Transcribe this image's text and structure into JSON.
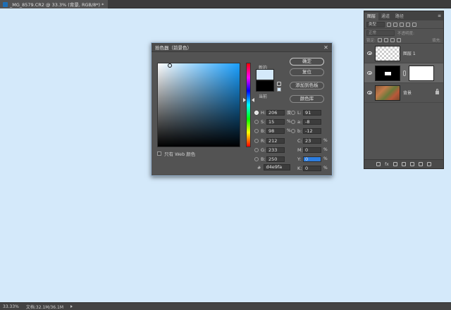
{
  "document": {
    "tab_title": "_MG_8579.CR2 @ 33.3% (背景, RGB/8*) *"
  },
  "status": {
    "zoom": "33.33%",
    "doc_info": "文档:32.1M/36.1M"
  },
  "color_picker": {
    "title": "拾色器（前景色）",
    "label_new": "新的",
    "label_current": "当前",
    "new_color": "#d4e9fa",
    "current_color": "#000000",
    "buttons": {
      "ok": "确定",
      "reset": "复位",
      "add_swatch": "添加到色板",
      "color_libraries": "颜色库"
    },
    "web_only_label": "只有 Web 颜色",
    "fields": {
      "H": "206",
      "H_unit": "度",
      "S": "15",
      "S_unit": "%",
      "B": "98",
      "B_unit": "%",
      "R": "212",
      "G": "233",
      "Bv": "250",
      "L": "91",
      "a": "-8",
      "b": "-12",
      "C": "23",
      "C_unit": "%",
      "M": "0",
      "M_unit": "%",
      "Y": "0",
      "Y_unit": "%",
      "K": "0",
      "K_unit": "%"
    },
    "field_labels": {
      "H": "H:",
      "S": "S:",
      "B": "B:",
      "R": "R:",
      "G": "G:",
      "Bv": "B:",
      "L": "L:",
      "a": "a:",
      "b": "b:",
      "C": "C:",
      "M": "M:",
      "Y": "Y:",
      "K": "K:"
    },
    "hex_label": "#",
    "hex": "d4e9fa"
  },
  "layers_panel": {
    "tabs": [
      "图层",
      "通道",
      "路径"
    ],
    "filter_label": "类型",
    "blend_mode": "正常",
    "opacity_label": "不透明度:",
    "lock_label": "锁定:",
    "fill_label": "填充:",
    "layers": [
      {
        "name": "图层 1"
      },
      {
        "name": ""
      },
      {
        "name": "背景"
      }
    ]
  }
}
